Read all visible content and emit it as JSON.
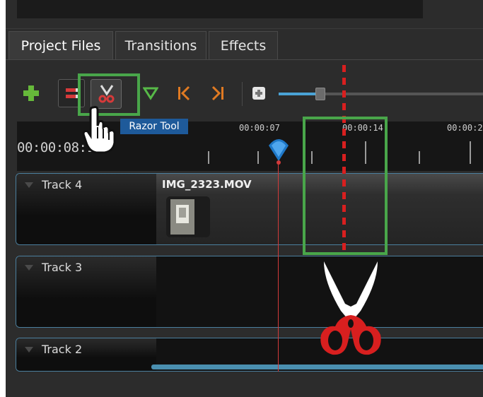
{
  "tabs": [
    {
      "label": "Project Files"
    },
    {
      "label": "Transitions"
    },
    {
      "label": "Effects"
    }
  ],
  "toolbar": {
    "tooltip": "Razor Tool",
    "icons": [
      "add-icon",
      "snap-icon",
      "razor-icon",
      "marker-icon",
      "previous-marker-icon",
      "next-marker-icon",
      "zoom-icon"
    ],
    "zoom_level_fraction": 0.2
  },
  "timeline": {
    "current_timecode": "00:00:08:14",
    "tick_labels": [
      "00:00:07",
      "00:00:14",
      "00:00:2"
    ]
  },
  "tracks": [
    {
      "name": "Track 4",
      "clip": "IMG_2323.MOV"
    },
    {
      "name": "Track 3"
    },
    {
      "name": "Track 2"
    }
  ],
  "colors": {
    "highlight": "#49a64a",
    "cut_line": "#d81f1f",
    "tooltip_bg": "#1e5a9a",
    "track_border": "#4b7f9e"
  }
}
